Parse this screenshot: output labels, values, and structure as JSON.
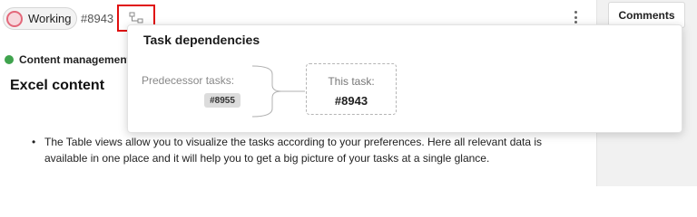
{
  "header": {
    "status_label": "Working",
    "task_id": "#8943",
    "status_color": "#e3687a",
    "dependencies_icon": "task-dependencies-icon",
    "more_icon": "vertical-dots-icon"
  },
  "side_panel": {
    "comments_tab_label": "Comments"
  },
  "content": {
    "project_name": "Content management",
    "project_color": "#3fa34d",
    "title": "Excel content",
    "description_items": [
      "The Table views allow you to visualize the tasks according to your preferences. Here all relevant data is available in one place and it will help you to get a big picture of your tasks at a single glance."
    ]
  },
  "popover": {
    "title": "Task dependencies",
    "predecessor_label": "Predecessor tasks:",
    "predecessor_ids": [
      "#8955"
    ],
    "this_task_label": "This task:",
    "this_task_id": "#8943"
  }
}
